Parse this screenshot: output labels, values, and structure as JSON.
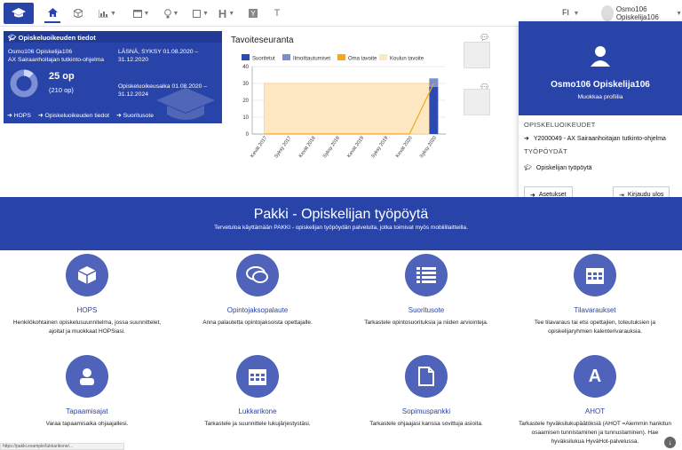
{
  "nav": {
    "lang": "FI",
    "user_name": "Osmo106 Opiskelija106"
  },
  "study_card": {
    "header": "Opiskeluoikeuden tiedot",
    "student": "Osmo106 Opiskelija106",
    "program": "AX Sairaanhoitajan tutkinto-ohjelma",
    "presence_1": "LÄSNÄ, SYKSY 01.08.2020 –",
    "presence_2": "31.12.2020",
    "credits": "25 op",
    "credits_total": "(210 op)",
    "period_1": "Opiskeluoikeusaika 01.08.2020 –",
    "period_2": "31.12.2024",
    "links": [
      "HOPS",
      "Opiskeluoikeuden tiedot",
      "Suoritusote"
    ]
  },
  "chart_data": {
    "type": "bar",
    "title": "Tavoiteseuranta",
    "categories": [
      "Kevät 2017",
      "Syksy 2017",
      "Kevät 2018",
      "Syksy 2018",
      "Kevät 2019",
      "Syksy 2019",
      "Kevät 2020",
      "Syksy 2020"
    ],
    "ylim": [
      0,
      40
    ],
    "yticks": [
      0,
      10,
      20,
      30,
      40
    ],
    "legend": [
      "Suoritetut",
      "Ilmoittautumiset",
      "Oma tavoite",
      "Koulun tavoite"
    ],
    "colors": {
      "suoritetut": "#2c4ab0",
      "ilmoittautumiset": "#7a8fcc",
      "oma_tavoite": "#f5a623",
      "koulun_tavoite": "#fde8c2"
    },
    "series": [
      {
        "name": "Suoritetut",
        "values": [
          0,
          0,
          0,
          0,
          0,
          0,
          0,
          28
        ]
      },
      {
        "name": "Ilmoittautumiset",
        "values": [
          0,
          0,
          0,
          0,
          0,
          0,
          0,
          5
        ]
      },
      {
        "name": "Oma tavoite",
        "values": [
          0,
          0,
          0,
          0,
          0,
          0,
          0,
          30
        ]
      },
      {
        "name": "Koulun tavoite",
        "values": [
          30,
          30,
          30,
          30,
          30,
          30,
          30,
          30
        ]
      }
    ]
  },
  "dropdown": {
    "name": "Osmo106 Opiskelija106",
    "edit": "Muokkaa profiilia",
    "sec_rights": "OPISKELUOIKEUDET",
    "right_item": "Y2000049 - AX Sairaanhoitajan tutkinto-ohjelma",
    "sec_desks": "TYÖPÖYDÄT",
    "desk_item": "Opiskelijan työpöytä",
    "settings": "Asetukset",
    "logout": "Kirjaudu ulos"
  },
  "banner": {
    "title": "Pakki - Opiskelijan työpöytä",
    "subtitle": "Tervetuloa käyttämään PAKKI - opiskelijan työpöydän palveluita, jotka toimivat myös mobiililaitteilla."
  },
  "tiles": [
    {
      "title": "HOPS",
      "desc": "Henkilökohtainen opiskelusuunnitelma, jossa suunnittelet, ajoitat ja muokkaat HOPSiasi."
    },
    {
      "title": "Opintojaksopalaute",
      "desc": "Anna palautetta opintojaksoista opettajalle."
    },
    {
      "title": "Suoritusote",
      "desc": "Tarkastele opintosuorituksia ja niiden arviointeja."
    },
    {
      "title": "Tilavaraukset",
      "desc": "Tee tilavaraus tai etsi opettajien, toteutuksien ja opiskelijaryhmien kalenterivarauksia."
    },
    {
      "title": "Tapaamisajat",
      "desc": "Varaa tapaamisaika ohjaajallesi."
    },
    {
      "title": "Lukkarikone",
      "desc": "Tarkastele ja suunnittele lukujärjestystäsi."
    },
    {
      "title": "Sopimuspankki",
      "desc": "Tarkastele ohjaajasi kanssa sovittuja asioita."
    },
    {
      "title": "AHOT",
      "desc": "Tarkastele hyväksilukupäätöksiä (AHOT =Aiemmin hankitun osaamisen tunnistaminen ja tunnustaminen). Hae hyväksilukua HyväHot-palvelussa."
    }
  ],
  "statusbar": "https://pakki.example/lukkarikone/...",
  "icons": [
    "graduation-cap-icon",
    "home-icon",
    "cube-icon",
    "chart-icon",
    "calendar-icon",
    "lightbulb-icon",
    "square-icon",
    "heading-icon",
    "yammer-icon",
    "text-icon",
    "comment-icon",
    "chevron-right-icon",
    "logout-icon",
    "arrow-down-icon",
    "user-icon",
    "document-icon",
    "list-icon"
  ]
}
